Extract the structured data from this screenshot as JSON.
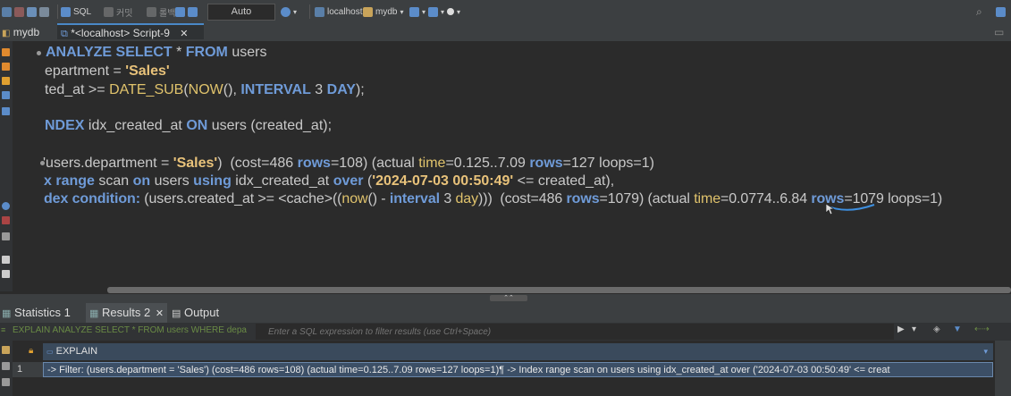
{
  "toolbar": {
    "sql_label": "SQL",
    "commit_label": "커밋",
    "rollback_label": "롤백",
    "mode_value": "Auto",
    "datasource": "localhost",
    "schema": "mydb"
  },
  "editor_tabs": {
    "db_tab": "mydb",
    "script_tab": "*<localhost> Script-9",
    "close": "✕"
  },
  "code": {
    "line1_kw1": "ANALYZE SELECT",
    "line1_rest": " * ",
    "line1_kw2": "FROM",
    "line1_tail": " users",
    "line2_a": "epartment = ",
    "line2_str": "'Sales'",
    "line3_a": "ted_at >= ",
    "line3_fn1": "DATE_SUB",
    "line3_b": "(",
    "line3_fn2": "NOW",
    "line3_c": "(), ",
    "line3_kw": "INTERVAL",
    "line3_d": " 3 ",
    "line3_kw2": "DAY",
    "line3_e": ");",
    "line4_kw1": "NDEX",
    "line4_a": " idx_created_at ",
    "line4_kw2": "ON",
    "line4_b": " users (created_at);",
    "line5_a": "'users.department = ",
    "line5_str": "'Sales'",
    "line5_b": ")  (cost=486 ",
    "line5_kw1": "rows",
    "line5_c": "=108) (actual ",
    "line5_fn": "time",
    "line5_d": "=0.125..7.09 ",
    "line5_kw2": "rows",
    "line5_e": "=127 loops=1)",
    "line6_kw1": "x range",
    "line6_a": " scan ",
    "line6_kw2": "on",
    "line6_b": " users ",
    "line6_kw3": "using",
    "line6_c": " idx_created_at ",
    "line6_kw4": "over",
    "line6_d": " (",
    "line6_str": "'2024-07-03 00:50:49'",
    "line6_e": " <= created_at),",
    "line7_kw1": "dex condition:",
    "line7_a": " (users.created_at >= <cache>((",
    "line7_fn1": "now",
    "line7_b": "() - ",
    "line7_kw2": "interval",
    "line7_c": " 3 ",
    "line7_fn2": "day",
    "line7_d": ")))  (cost=486 ",
    "line7_kw3": "rows",
    "line7_e": "=1079) (actual ",
    "line7_fn3": "time",
    "line7_f": "=0.0774..6.84 ",
    "line7_kw4": "rows",
    "line7_g": "=1079 loops=1)"
  },
  "result_tabs": {
    "statistics": "Statistics 1",
    "results": "Results 2",
    "output": "Output",
    "close": "✕"
  },
  "filter": {
    "query_text": "EXPLAIN ANALYZE SELECT * FROM users WHERE depa",
    "placeholder": "Enter a SQL expression to filter results (use Ctrl+Space)"
  },
  "grid": {
    "column": "EXPLAIN",
    "row_number": "1",
    "row_value": "-> Filter: (users.department = 'Sales')  (cost=486 rows=108) (actual time=0.125..7.09 rows=127 loops=1)¶    -> Index range scan on users using idx_created_at over ('2024-07-03 00:50:49' <= creat"
  },
  "colors": {
    "keyword": "#6f9bd8",
    "function": "#e0c36c",
    "string": "#e8c27a",
    "selection": "#3c4f66",
    "underline": "#3d8fe0"
  }
}
